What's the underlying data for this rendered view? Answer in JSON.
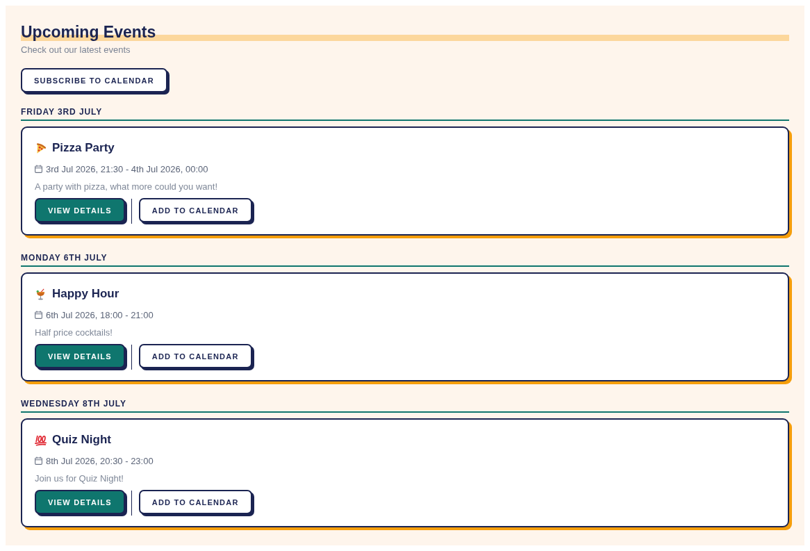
{
  "header": {
    "title": "Upcoming Events",
    "subtitle": "Check out our latest events"
  },
  "subscribe_button": {
    "label": "SUBSCRIBE TO CALENDAR",
    "kind": "outline"
  },
  "days": [
    {
      "heading": "FRIDAY 3RD JULY",
      "events": [
        {
          "kind": "pizza",
          "title": "Pizza Party",
          "when": "3rd Jul 2026, 21:30 - 4th Jul 2026, 00:00",
          "description": "A party with pizza, what more could you want!",
          "buttons": [
            {
              "label": "VIEW DETAILS",
              "kind": "filled"
            },
            {
              "label": "ADD TO CALENDAR",
              "kind": "outline"
            }
          ]
        }
      ]
    },
    {
      "heading": "MONDAY 6TH JULY",
      "events": [
        {
          "kind": "cocktail",
          "title": "Happy Hour",
          "when": "6th Jul 2026, 18:00 - 21:00",
          "description": "Half price cocktails!",
          "buttons": [
            {
              "label": "VIEW DETAILS",
              "kind": "filled"
            },
            {
              "label": "ADD TO CALENDAR",
              "kind": "outline"
            }
          ]
        }
      ]
    },
    {
      "heading": "WEDNESDAY 8TH JULY",
      "events": [
        {
          "kind": "hundred",
          "title": "Quiz Night",
          "when": "8th Jul 2026, 20:30 - 23:00",
          "description": "Join us for Quiz Night!",
          "buttons": [
            {
              "label": "VIEW DETAILS",
              "kind": "filled"
            },
            {
              "label": "ADD TO CALENDAR",
              "kind": "outline"
            }
          ]
        }
      ]
    }
  ]
}
